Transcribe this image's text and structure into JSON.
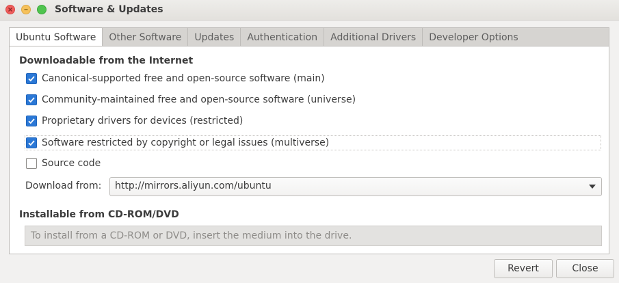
{
  "window": {
    "title": "Software & Updates"
  },
  "tabs": [
    {
      "label": "Ubuntu Software",
      "active": true
    },
    {
      "label": "Other Software",
      "active": false
    },
    {
      "label": "Updates",
      "active": false
    },
    {
      "label": "Authentication",
      "active": false
    },
    {
      "label": "Additional Drivers",
      "active": false
    },
    {
      "label": "Developer Options",
      "active": false
    }
  ],
  "internet": {
    "heading": "Downloadable from the Internet",
    "options": [
      {
        "label": "Canonical-supported free and open-source software (main)",
        "checked": true
      },
      {
        "label": "Community-maintained free and open-source software (universe)",
        "checked": true
      },
      {
        "label": "Proprietary drivers for devices (restricted)",
        "checked": true
      },
      {
        "label": "Software restricted by copyright or legal issues (multiverse)",
        "checked": true
      },
      {
        "label": "Source code",
        "checked": false
      }
    ],
    "download_from_label": "Download from:",
    "download_from_value": "http://mirrors.aliyun.com/ubuntu"
  },
  "cdrom": {
    "heading": "Installable from CD-ROM/DVD",
    "placeholder": "To install from a CD-ROM or DVD, insert the medium into the drive."
  },
  "buttons": {
    "revert": "Revert",
    "close": "Close"
  },
  "colors": {
    "accent": "#2b78d6",
    "close_dot": "#f05d5b",
    "minimize_dot": "#f6c15a",
    "maximize_dot": "#4fc44e"
  }
}
